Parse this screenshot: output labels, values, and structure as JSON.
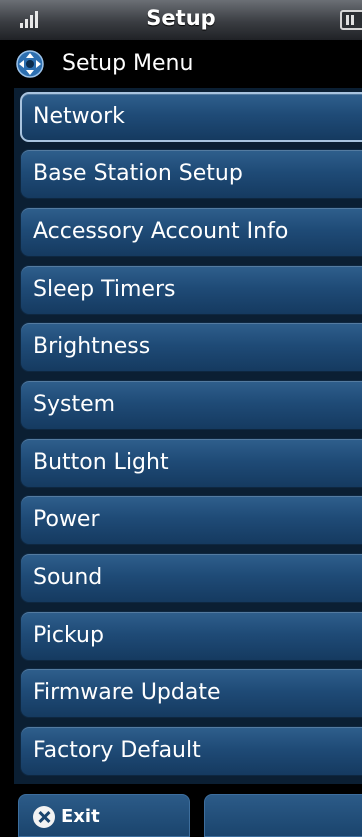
{
  "status_bar": {
    "title": "Setup",
    "signal_icon": "signal-bars-icon",
    "battery_icon": "battery-icon"
  },
  "header": {
    "icon": "navigation-dpad-icon",
    "title": "Setup Menu"
  },
  "menu": {
    "selected_index": 0,
    "items": [
      {
        "label": "Network"
      },
      {
        "label": "Base Station Setup"
      },
      {
        "label": "Accessory Account Info"
      },
      {
        "label": "Sleep Timers"
      },
      {
        "label": "Brightness"
      },
      {
        "label": "System"
      },
      {
        "label": "Button Light"
      },
      {
        "label": "Power"
      },
      {
        "label": "Sound"
      },
      {
        "label": "Pickup"
      },
      {
        "label": "Firmware Update"
      },
      {
        "label": "Factory Default"
      }
    ]
  },
  "softkeys": {
    "left_label": "Exit",
    "left_icon": "close-circle-icon",
    "right_label": ""
  },
  "colors": {
    "menu_button": "#1f4b77",
    "menu_panel": "#0b1f33",
    "selected_border": "#a9c4df",
    "text": "#ffffff"
  }
}
